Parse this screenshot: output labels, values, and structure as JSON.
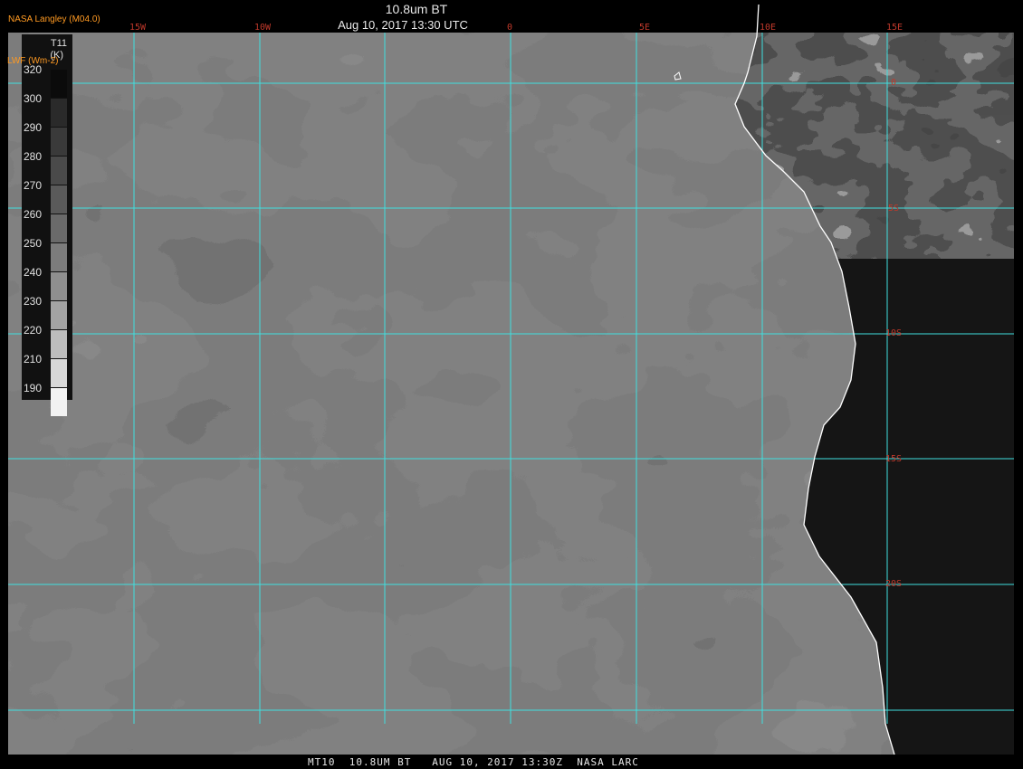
{
  "header": {
    "credit": "NASA Langley (M04.0)",
    "title": "10.8um BT",
    "subtitle": "Aug 10, 2017 13:30 UTC"
  },
  "footer": {
    "text": "MT10  10.8UM BT   AUG 10, 2017 13:30Z  NASA LARC"
  },
  "legend": {
    "name": "T11",
    "unit": "(K)",
    "variable": "LWF (Wm-2)",
    "labels": [
      "320",
      "300",
      "290",
      "280",
      "270",
      "260",
      "250",
      "240",
      "230",
      "220",
      "210",
      "190"
    ],
    "swatch_colors": [
      "#0b0b0b",
      "#2a2a2a",
      "#3a3a3a",
      "#4a4a4a",
      "#5a5a5a",
      "#6a6a6a",
      "#7c7c7c",
      "#8f8f8f",
      "#a3a3a3",
      "#bdbdbd",
      "#d8d8d8",
      "#f2f2f2"
    ]
  },
  "map": {
    "longitude_labels": [
      "15W",
      "10W",
      "0",
      "5E",
      "10E",
      "15E"
    ],
    "latitude_labels": [
      "0",
      "5S",
      "10S",
      "15S",
      "20S"
    ],
    "grid_color": "#3fe0e0",
    "coast_color": "#ffffff",
    "label_color": "#c0392b"
  }
}
